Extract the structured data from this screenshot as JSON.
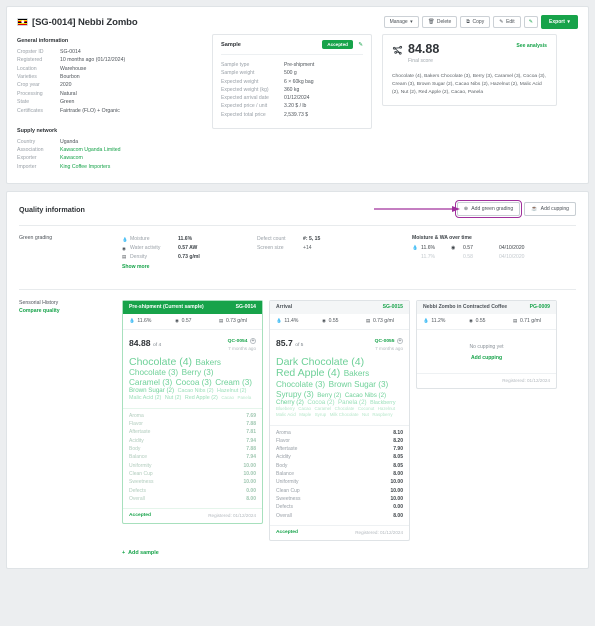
{
  "header": {
    "flag_alt": "uganda-flag",
    "title": "[SG-0014] Nebbi Zombo",
    "toolbar": {
      "manage": "Manage",
      "delete": "Delete",
      "copy": "Copy",
      "edit": "Edit",
      "export": "Export"
    }
  },
  "general_information": {
    "title": "General information",
    "rows": [
      {
        "key": "Cropster ID",
        "value": "SG-0014"
      },
      {
        "key": "Registered",
        "value": "10 months ago (01/12/2024)"
      },
      {
        "key": "Location",
        "value": "Warehouse"
      },
      {
        "key": "Varieties",
        "value": "Bourbon"
      },
      {
        "key": "Crop year",
        "value": "2020"
      },
      {
        "key": "Processing",
        "value": "Natural"
      },
      {
        "key": "State",
        "value": "Green"
      },
      {
        "key": "Certificates",
        "value": "Fairtrade (FLO) + Organic"
      }
    ]
  },
  "supply_network": {
    "title": "Supply network",
    "rows": [
      {
        "key": "Country",
        "value": "Uganda",
        "link": false
      },
      {
        "key": "Association",
        "value": "Kawacom Uganda Limited",
        "link": true
      },
      {
        "key": "Exporter",
        "value": "Kawacom",
        "link": true
      },
      {
        "key": "Importer",
        "value": "King Coffee Importers",
        "link": true
      }
    ]
  },
  "sample_card": {
    "title": "Sample",
    "status": "Accepted",
    "edit_icon": "pencil-icon",
    "rows": [
      {
        "key": "Sample type",
        "value": "Pre-shipment"
      },
      {
        "key": "Sample weight",
        "value": "500 g"
      },
      {
        "key": "Expected weight",
        "value": "6 × 60kg bag"
      },
      {
        "key": "Expected weight (kg)",
        "value": "360 kg"
      },
      {
        "key": "Expected arrival date",
        "value": "01/12/2024"
      },
      {
        "key": "Expected price / unit",
        "value": "3.20 $ / lb"
      },
      {
        "key": "Expected total price",
        "value": "2,539.73 $"
      }
    ]
  },
  "score_card": {
    "score": "84.88",
    "score_label": "Final score",
    "see_analysis": "See analysis",
    "notes": "Chocolate (4), Bakers Chocolate (3), Berry (3), Caramel (3), Cocoa (3), Cream (3), Brown Sugar (2), Cacao Nibs (2), Hazelnut (2), Malic Acid (2), Nut (2), Red Apple (2), Cacao, Panela"
  },
  "quality": {
    "title": "Quality information",
    "add_green_grading": "Add green grading",
    "add_cupping": "Add cupping",
    "green_grading_label": "Green grading",
    "metrics": [
      {
        "icon": "droplet-icon",
        "key": "Moisture",
        "value": "11.6%"
      },
      {
        "icon": "water-activity-icon",
        "key": "Water activity",
        "value": "0.57 AW"
      },
      {
        "icon": "density-icon",
        "key": "Density",
        "value": "0.73 g/ml"
      }
    ],
    "show_more": "Show more",
    "defects": [
      {
        "key": "Defect count",
        "value": "#: 5, 15",
        "bold": true
      },
      {
        "key": "Screen size",
        "value": "+14",
        "bold": false
      }
    ],
    "over_time": {
      "title": "Moisture & WA over time",
      "rows": [
        {
          "moisture": "11.6%",
          "wa": "0.57",
          "date": "04/10/2020",
          "faded": false
        },
        {
          "moisture": "11.7%",
          "wa": "0.58",
          "date": "04/10/2020",
          "faded": true
        }
      ]
    }
  },
  "sensorial": {
    "label": "Sensorial History",
    "compare": "Compare quality",
    "add_sample": "Add sample",
    "cards": [
      {
        "title": "Pre-shipment (Current sample)",
        "sample_id": "SG-0014",
        "highlighted": true,
        "moisture": "11.6%",
        "water_activity": "0.57",
        "density": "0.73 g/ml",
        "score": "84.88",
        "of": "of 4",
        "qc_id": "QC-0054",
        "ago": "7 months ago",
        "tags": [
          {
            "text": "Chocolate (4)",
            "size": "t4"
          },
          {
            "text": "Bakers",
            "size": "t3"
          },
          {
            "text": "Chocolate (3)",
            "size": "t3"
          },
          {
            "text": "Berry (3)",
            "size": "t3"
          },
          {
            "text": "Caramel (3)",
            "size": "t3"
          },
          {
            "text": "Cocoa (3)",
            "size": "t3"
          },
          {
            "text": "Cream (3)",
            "size": "t3"
          },
          {
            "text": "Brown Sugar (2)",
            "size": "t2s"
          },
          {
            "text": "Cacao Nibs (2)",
            "size": "t2"
          },
          {
            "text": "Hazelnut (2)",
            "size": "t2"
          },
          {
            "text": "Malic Acid (2)",
            "size": "t2"
          },
          {
            "text": "Nut (2)",
            "size": "t2"
          },
          {
            "text": "Red Apple (2)",
            "size": "t2"
          },
          {
            "text": "Cacao",
            "size": "t1"
          },
          {
            "text": "Panela",
            "size": "t1"
          }
        ],
        "attributes": [
          {
            "name": "Aroma",
            "value": "7.69"
          },
          {
            "name": "Flavor",
            "value": "7.88"
          },
          {
            "name": "Aftertaste",
            "value": "7.81"
          },
          {
            "name": "Acidity",
            "value": "7.94"
          },
          {
            "name": "Body",
            "value": "7.88"
          },
          {
            "name": "Balance",
            "value": "7.94"
          },
          {
            "name": "Uniformity",
            "value": "10.00"
          },
          {
            "name": "Clean Cup",
            "value": "10.00"
          },
          {
            "name": "Sweetness",
            "value": "10.00"
          },
          {
            "name": "Defects",
            "value": "0.00"
          },
          {
            "name": "Overall",
            "value": "8.00"
          }
        ],
        "status": "Accepted",
        "registered": "Registered: 01/12/2024"
      },
      {
        "title": "Arrival",
        "sample_id": "SG-0015",
        "highlighted": false,
        "moisture": "11.4%",
        "water_activity": "0.55",
        "density": "0.73 g/ml",
        "score": "85.7",
        "of": "of 5",
        "qc_id": "QC-0055",
        "ago": "7 months ago",
        "tags": [
          {
            "text": "Dark Chocolate (4)",
            "size": "t4"
          },
          {
            "text": "Red Apple (4)",
            "size": "t4"
          },
          {
            "text": "Bakers",
            "size": "t3"
          },
          {
            "text": "Chocolate (3)",
            "size": "t3"
          },
          {
            "text": "Brown Sugar (3)",
            "size": "t3"
          },
          {
            "text": "Syrupy (3)",
            "size": "t3"
          },
          {
            "text": "Berry (2)",
            "size": "t2s"
          },
          {
            "text": "Cacao Nibs (2)",
            "size": "t2s"
          },
          {
            "text": "Cherry (2)",
            "size": "t2s"
          },
          {
            "text": "Cocoa (2)",
            "size": "t2s"
          },
          {
            "text": "Panela (2)",
            "size": "t2s"
          },
          {
            "text": "Blackberry",
            "size": "t2"
          },
          {
            "text": "Blueberry",
            "size": "t1"
          },
          {
            "text": "Cacao",
            "size": "t1"
          },
          {
            "text": "Caramel",
            "size": "t1"
          },
          {
            "text": "Chocolate",
            "size": "t1"
          },
          {
            "text": "Coconut",
            "size": "t1"
          },
          {
            "text": "Hazelnut",
            "size": "t1"
          },
          {
            "text": "Malic Acid",
            "size": "t1"
          },
          {
            "text": "Maple",
            "size": "t1"
          },
          {
            "text": "Syrup",
            "size": "t1"
          },
          {
            "text": "Milk Chocolate",
            "size": "t1"
          },
          {
            "text": "Nut",
            "size": "t1"
          },
          {
            "text": "Raspberry",
            "size": "t1"
          }
        ],
        "attributes": [
          {
            "name": "Aroma",
            "value": "8.10"
          },
          {
            "name": "Flavor",
            "value": "8.20"
          },
          {
            "name": "Aftertaste",
            "value": "7.90"
          },
          {
            "name": "Acidity",
            "value": "8.05"
          },
          {
            "name": "Body",
            "value": "8.05"
          },
          {
            "name": "Balance",
            "value": "8.00"
          },
          {
            "name": "Uniformity",
            "value": "10.00"
          },
          {
            "name": "Clean Cup",
            "value": "10.00"
          },
          {
            "name": "Sweetness",
            "value": "10.00"
          },
          {
            "name": "Defects",
            "value": "0.00"
          },
          {
            "name": "Overall",
            "value": "8.00"
          }
        ],
        "status": "Accepted",
        "registered": "Registered: 01/12/2024"
      },
      {
        "title": "Nebbi Zombo in Contracted Coffee",
        "sample_id": "PG-0009",
        "highlighted": false,
        "moisture": "11.2%",
        "water_activity": "0.55",
        "density": "0.71 g/ml",
        "empty_text": "No cupping yet",
        "empty_action": "Add cupping",
        "registered": "Registered: 01/12/2024"
      }
    ]
  },
  "colors": {
    "green": "#17a34a",
    "tag_green": "#6ed098",
    "purple_annotation": "#a0309c",
    "bg": "#eceef0"
  }
}
